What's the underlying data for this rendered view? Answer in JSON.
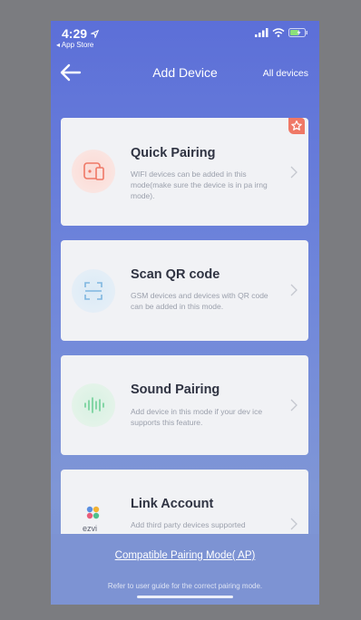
{
  "status_bar": {
    "time": "4:29",
    "back_app": "◂ App Store",
    "location_icon": "location-arrow-icon",
    "signal_icon": "cellular-signal-icon",
    "wifi_icon": "wifi-icon",
    "battery_icon": "battery-charging-icon"
  },
  "header": {
    "title": "Add Device",
    "all_devices": "All devices",
    "back_icon": "back-arrow-icon"
  },
  "cards": [
    {
      "title": "Quick Pairing",
      "description": "WIFI devices can be added in this mode(make sure the device is in pa irng mode).",
      "icon": "phone-device-icon",
      "badge_icon": "star-badge-icon"
    },
    {
      "title": "Scan QR code",
      "description": "GSM devices and devices with QR code can be added in this mode.",
      "icon": "scan-frame-icon"
    },
    {
      "title": "Sound Pairing",
      "description": "Add device in this mode if your dev ice supports this feature.",
      "icon": "sound-wave-icon"
    },
    {
      "title": "Link Account",
      "description": "Add third party devices supported",
      "icon": "ezviz-logo-icon",
      "logo_text": "ezvi"
    }
  ],
  "footer": {
    "compatible_mode": "Compatible Pairing Mode( AP)",
    "hint": "Refer to user guide for the correct pairing mode."
  },
  "colors": {
    "background_top": "#5c6fd8",
    "card": "#f1f2f5",
    "quick_pairing_accent": "#ef7866",
    "qr_accent": "#7fb6e0",
    "sound_accent": "#6fcf97"
  }
}
